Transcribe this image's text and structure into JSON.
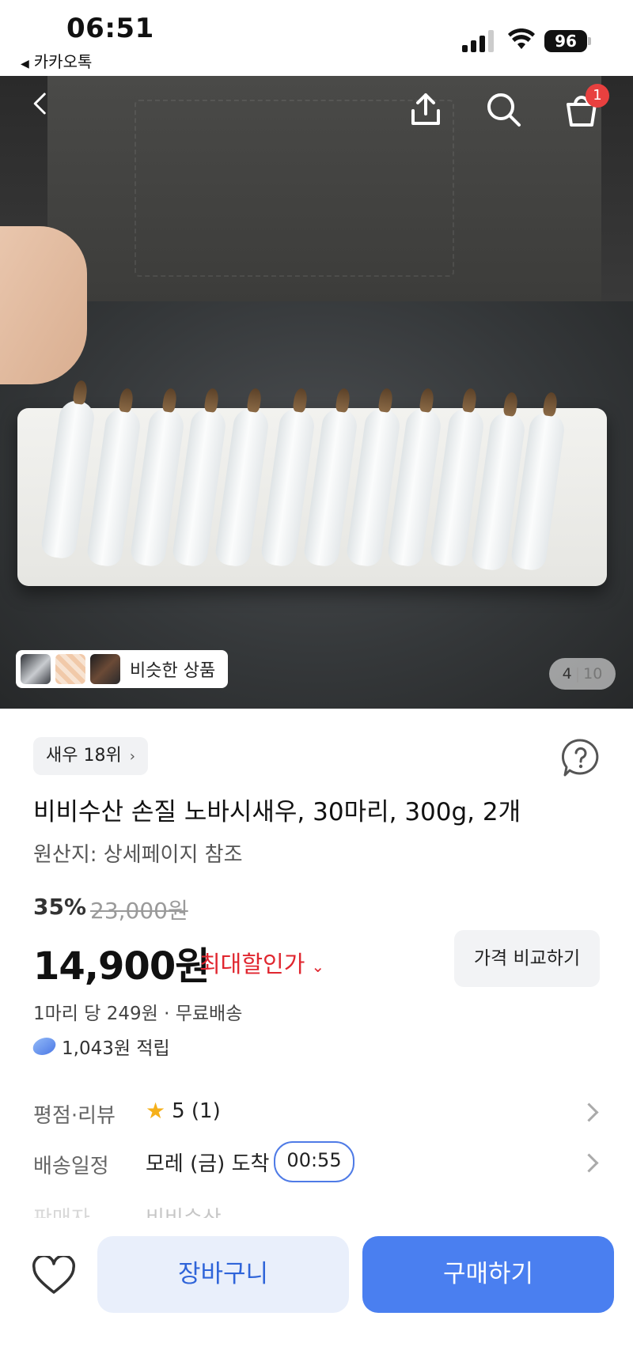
{
  "status_bar": {
    "time": "06:51",
    "back_app": "카카오톡",
    "battery": "96"
  },
  "hero": {
    "cart_badge": "1",
    "similar_label": "비슷한 상품",
    "page_current": "4",
    "page_total": "10"
  },
  "product": {
    "rank_chip": "새우 18위",
    "title": "비비수산 손질 노바시새우, 30마리, 300g, 2개",
    "origin": "원산지: 상세페이지 참조",
    "discount": "35%",
    "original_price": "23,000원",
    "price": "14,900원",
    "max_discount_label": "최대할인가",
    "compare_button": "가격 비교하기",
    "unit_info": "1마리 당 249원 · 무료배송",
    "points": "1,043원 적립"
  },
  "info_rows": {
    "rating_label": "평점·리뷰",
    "rating_value": "5 (1)",
    "delivery_label": "배송일정",
    "delivery_value": "모레 (금) 도착",
    "delivery_timer": "00:55",
    "seller_label": "판매자",
    "seller_value": "비비수산"
  },
  "bottom_bar": {
    "cart_button": "장바구니",
    "buy_button": "구매하기"
  },
  "colors": {
    "accent_blue": "#4a7ff0",
    "discount_red": "#e0262f",
    "badge_red": "#e8403f",
    "star_yellow": "#f5b01a"
  }
}
